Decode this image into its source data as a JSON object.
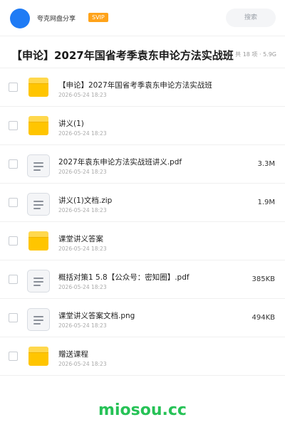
{
  "header": {
    "share_name": "夸克网盘分享",
    "badge": "SVIP",
    "search_placeholder": "搜索"
  },
  "folder": {
    "title": "【申论】2027年国省考季袁东申论方法实战班",
    "summary": "共 18 项 · 5.9G"
  },
  "files": [
    {
      "name": "【申论】2027年国省考季袁东申论方法实战班",
      "date": "2026-05-24 18:23",
      "type": "folder",
      "size": ""
    },
    {
      "name": "讲义(1)",
      "date": "2026-05-24 18:23",
      "type": "folder",
      "size": ""
    },
    {
      "name": "2027年袁东申论方法实战班讲义.pdf",
      "date": "2026-05-24 18:23",
      "type": "file",
      "size": "3.3M"
    },
    {
      "name": "讲义(1)文档.zip",
      "date": "2026-05-24 18:23",
      "type": "file",
      "size": "1.9M"
    },
    {
      "name": "课堂讲义答案",
      "date": "2026-05-24 18:23",
      "type": "folder",
      "size": ""
    },
    {
      "name": "概括对策1 5.8【公众号：密知圈】.pdf",
      "date": "2026-05-24 18:23",
      "type": "file",
      "size": "385KB"
    },
    {
      "name": "课堂讲义答案文档.png",
      "date": "2026-05-24 18:23",
      "type": "file",
      "size": "494KB"
    },
    {
      "name": "赠送课程",
      "date": "2026-05-24 18:23",
      "type": "folder",
      "size": ""
    }
  ],
  "watermark": "miosou.cc",
  "colors": {
    "avatar": "#1f7bf5",
    "svip_badge": "#ffa31a",
    "folder": "#ffc500",
    "watermark": "#26c256"
  }
}
